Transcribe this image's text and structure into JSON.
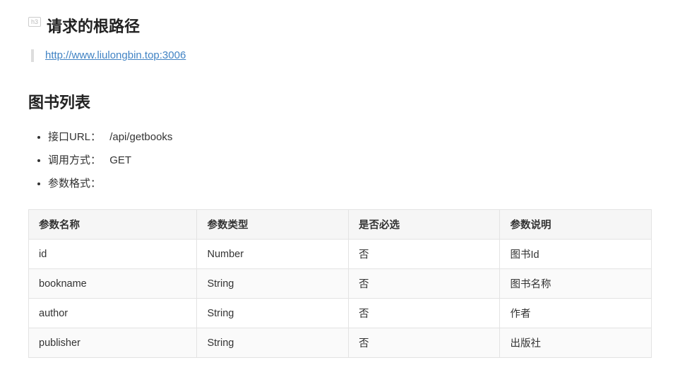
{
  "badge": "h3",
  "root_path": {
    "title": "请求的根路径",
    "url": "http://www.liulongbin.top:3006"
  },
  "book_list": {
    "title": "图书列表",
    "items": [
      {
        "label": "接口URL：",
        "value": "/api/getbooks"
      },
      {
        "label": "调用方式：",
        "value": "GET"
      },
      {
        "label": "参数格式：",
        "value": ""
      }
    ],
    "table": {
      "headers": [
        "参数名称",
        "参数类型",
        "是否必选",
        "参数说明"
      ],
      "rows": [
        [
          "id",
          "Number",
          "否",
          "图书Id"
        ],
        [
          "bookname",
          "String",
          "否",
          "图书名称"
        ],
        [
          "author",
          "String",
          "否",
          "作者"
        ],
        [
          "publisher",
          "String",
          "否",
          "出版社"
        ]
      ]
    }
  }
}
